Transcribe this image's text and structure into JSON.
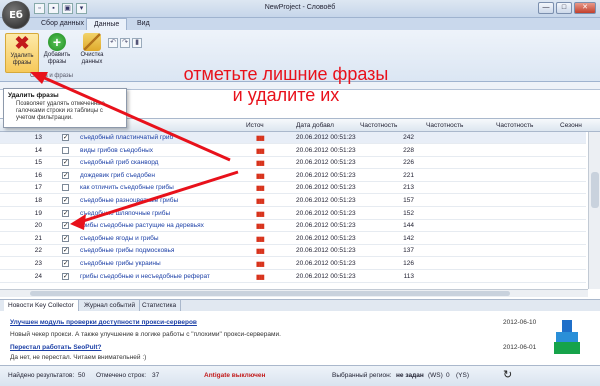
{
  "window": {
    "title": "NewProject - Словоёб",
    "logo_text": "Eб",
    "controls": [
      "—",
      "□",
      "✕"
    ]
  },
  "ribbon_tabs": [
    "Сбор данных",
    "Данные",
    "Вид"
  ],
  "ribbon": {
    "buttons": [
      {
        "label": "Удалить фразы",
        "icon": "delete-x-icon"
      },
      {
        "label": "Добавить фразы",
        "icon": "add-plus-icon"
      },
      {
        "label": "Очистка данных",
        "icon": "broom-icon"
      }
    ],
    "group_label": "Слова и фразы"
  },
  "tooltip": {
    "title": "Удалить фразы",
    "description": "Позволяет удалять отмеченные галочками строки из таблицы с учетом фильтрации."
  },
  "annotation": {
    "line1": "отметьте лишние фразы",
    "line2": "и удалите их",
    "color": "#e8111b"
  },
  "grid": {
    "columns": [
      "Источ",
      "Дата добавл",
      "Частотность",
      "Частотность",
      "Частотность",
      "Сезонн"
    ],
    "rows": [
      {
        "num": "13",
        "checked": true,
        "phrase": "съедобный пластинчатый гриб",
        "date": "20.06.2012 00:51:23",
        "freq": "242"
      },
      {
        "num": "14",
        "checked": false,
        "phrase": "виды грибов съедобных",
        "date": "20.06.2012 00:51:23",
        "freq": "228"
      },
      {
        "num": "15",
        "checked": true,
        "phrase": "съедобный гриб сканворд",
        "date": "20.06.2012 00:51:23",
        "freq": "226"
      },
      {
        "num": "16",
        "checked": true,
        "phrase": "дождевик гриб съедобен",
        "date": "20.06.2012 00:51:23",
        "freq": "221"
      },
      {
        "num": "17",
        "checked": false,
        "phrase": "как отличить съедобные грибы",
        "date": "20.06.2012 00:51:23",
        "freq": "213"
      },
      {
        "num": "18",
        "checked": true,
        "phrase": "съедобные разноцветные грибы",
        "date": "20.06.2012 00:51:23",
        "freq": "157"
      },
      {
        "num": "19",
        "checked": true,
        "phrase": "съедобные шляпочные грибы",
        "date": "20.06.2012 00:51:23",
        "freq": "152"
      },
      {
        "num": "20",
        "checked": true,
        "phrase": "грибы съедобные растущие на деревьях",
        "date": "20.06.2012 00:51:23",
        "freq": "144"
      },
      {
        "num": "21",
        "checked": true,
        "phrase": "съедобные ягоды и грибы",
        "date": "20.06.2012 00:51:23",
        "freq": "142"
      },
      {
        "num": "22",
        "checked": true,
        "phrase": "съедобные грибы подмосковья",
        "date": "20.06.2012 00:51:23",
        "freq": "137"
      },
      {
        "num": "23",
        "checked": true,
        "phrase": "съедобные грибы украины",
        "date": "20.06.2012 00:51:23",
        "freq": "126"
      },
      {
        "num": "24",
        "checked": true,
        "phrase": "грибы съедобные и несъедобные реферат",
        "date": "20.06.2012 00:51:23",
        "freq": "113"
      }
    ]
  },
  "bottom_tabs": [
    "Новости Key Collector",
    "Журнал событий",
    "Статистика"
  ],
  "news": [
    {
      "title": "Улучшен модуль проверки доступности прокси-серверов",
      "date": "2012-06-10",
      "desc": "Новый чекер прокси. А также улучшение в логике работы с \"плохими\" прокси-серверами."
    },
    {
      "title": "Перестал работать SeoPult?",
      "date": "2012-06-01",
      "desc": "Да нет, не перестал. Читаем внимательней :)"
    }
  ],
  "status": {
    "found_label": "Найдено результатов:",
    "found_value": "50",
    "marked_label": "Отмечено строк:",
    "marked_value": "37",
    "antigate": "Antigate выключен",
    "region_label": "Выбранный регион:",
    "region_value": "не задан",
    "ws": "(WS)",
    "zero": "0",
    "ys": "(YS)"
  }
}
